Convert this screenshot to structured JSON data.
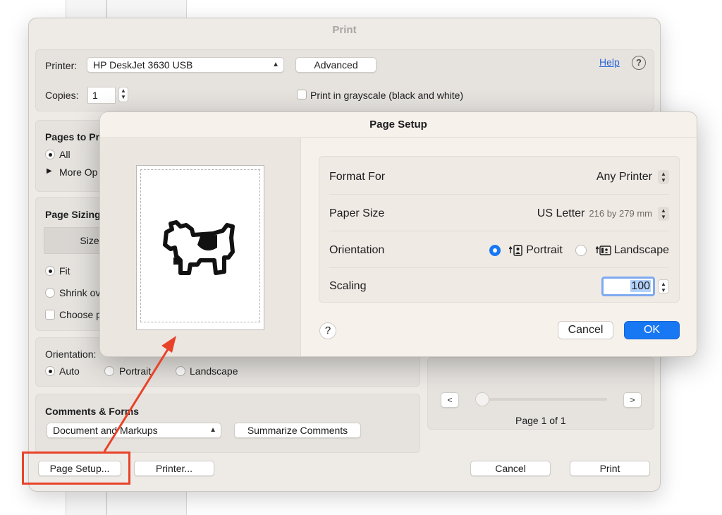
{
  "print_dialog": {
    "title": "Print",
    "printer_label": "Printer:",
    "printer_value": "HP DeskJet 3630 USB",
    "advanced_button": "Advanced",
    "help_link": "Help",
    "help_icon": "?",
    "copies_label": "Copies:",
    "copies_value": "1",
    "grayscale_label": "Print in grayscale (black and white)",
    "pages_heading": "Pages to Pr",
    "pages_all": "All",
    "more_options": "More Op",
    "page_sizing_heading": "Page Sizing",
    "size_button": "Size",
    "fit_label": "Fit",
    "shrink_label": "Shrink ov",
    "choose_label": "Choose p",
    "orientation_label": "Orientation:",
    "orient_auto": "Auto",
    "orient_portrait": "Portrait",
    "orient_landscape": "Landscape",
    "comments_heading": "Comments & Forms",
    "comments_value": "Document and Markups",
    "summarize_button": "Summarize Comments",
    "prev_button": "<",
    "next_button": ">",
    "page_indicator": "Page 1 of 1",
    "page_setup_button": "Page Setup...",
    "printer_button": "Printer...",
    "cancel_button": "Cancel",
    "print_button": "Print"
  },
  "page_setup": {
    "title": "Page Setup",
    "format_for_label": "Format For",
    "format_for_value": "Any Printer",
    "paper_size_label": "Paper Size",
    "paper_size_value": "US Letter",
    "paper_size_dims": "216 by 279 mm",
    "orientation_label": "Orientation",
    "portrait_label": "Portrait",
    "landscape_label": "Landscape",
    "orientation_selected": "Portrait",
    "scaling_label": "Scaling",
    "scaling_value": "100",
    "help_icon": "?",
    "cancel_button": "Cancel",
    "ok_button": "OK"
  },
  "colors": {
    "accent": "#1877f2",
    "annotation": "#e8432a",
    "link": "#2a66d6"
  },
  "icons": [
    "chevron-updown-icon",
    "help-icon",
    "dogcow-icon",
    "portrait-orientation-icon",
    "landscape-orientation-icon",
    "annotation-arrow"
  ]
}
